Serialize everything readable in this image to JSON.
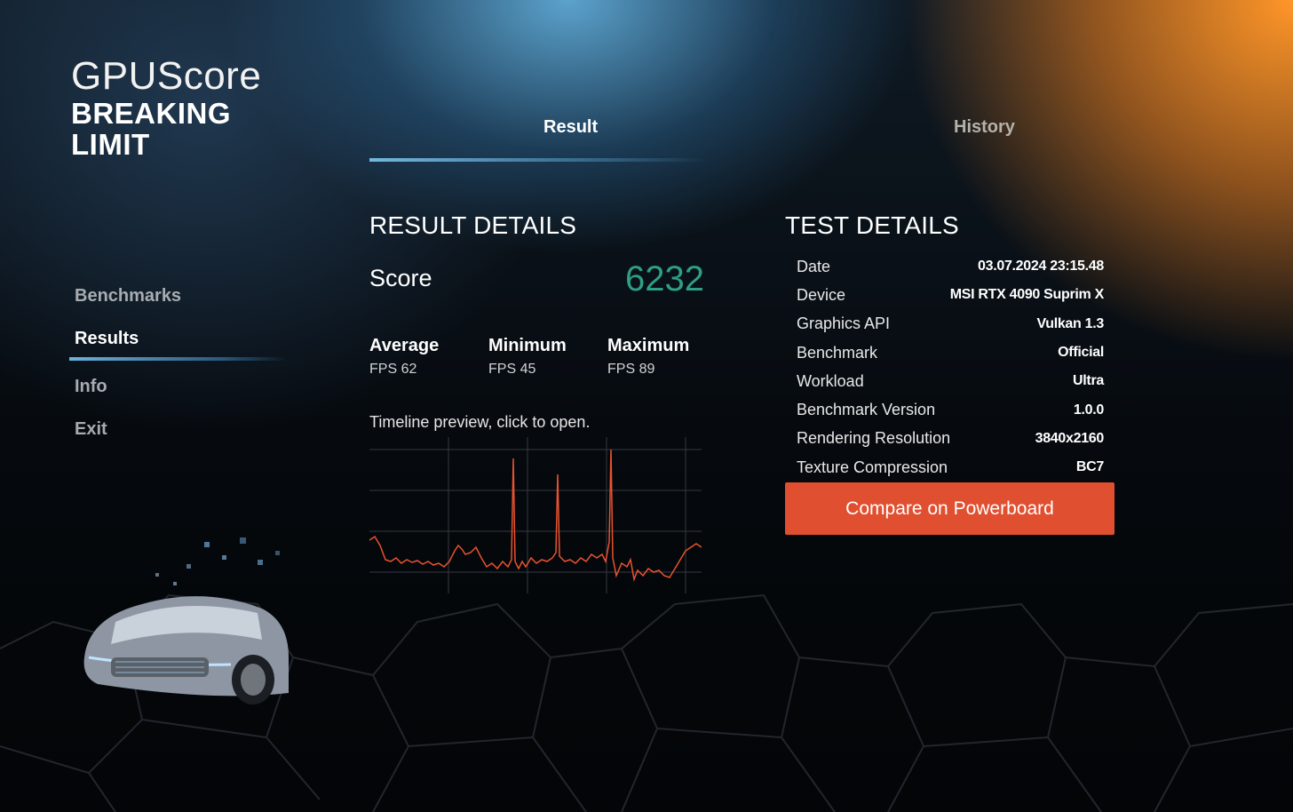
{
  "app": {
    "logo_line1": "GPUScore",
    "logo_line2": "BREAKING",
    "logo_line3": "LIMIT"
  },
  "nav": {
    "items": [
      {
        "label": "Benchmarks",
        "active": false
      },
      {
        "label": "Results",
        "active": true
      },
      {
        "label": "Info",
        "active": false
      },
      {
        "label": "Exit",
        "active": false
      }
    ]
  },
  "tabs": [
    {
      "label": "Result",
      "active": true
    },
    {
      "label": "History",
      "active": false
    }
  ],
  "result_details": {
    "title": "RESULT DETAILS",
    "score_label": "Score",
    "score_value": "6232",
    "stats": [
      {
        "label": "Average",
        "value": "FPS 62"
      },
      {
        "label": "Minimum",
        "value": "FPS 45"
      },
      {
        "label": "Maximum",
        "value": "FPS 89"
      }
    ],
    "timeline_text": "Timeline preview, click to open."
  },
  "test_details": {
    "title": "TEST DETAILS",
    "rows": [
      {
        "key": "Date",
        "value": "03.07.2024 23:15.48"
      },
      {
        "key": "Device",
        "value": "MSI RTX 4090 Suprim X"
      },
      {
        "key": "Graphics API",
        "value": "Vulkan 1.3"
      },
      {
        "key": "Benchmark",
        "value": "Official"
      },
      {
        "key": "Workload",
        "value": "Ultra"
      },
      {
        "key": "Benchmark Version",
        "value": "1.0.0"
      },
      {
        "key": "Rendering Resolution",
        "value": "3840x2160"
      },
      {
        "key": "Texture Compression",
        "value": "BC7"
      }
    ],
    "compare_button": "Compare on Powerboard"
  },
  "colors": {
    "accent_blue": "#6cb3de",
    "score_green": "#2e9f82",
    "button_orange": "#e04f30",
    "timeline_line": "#e8532f"
  }
}
